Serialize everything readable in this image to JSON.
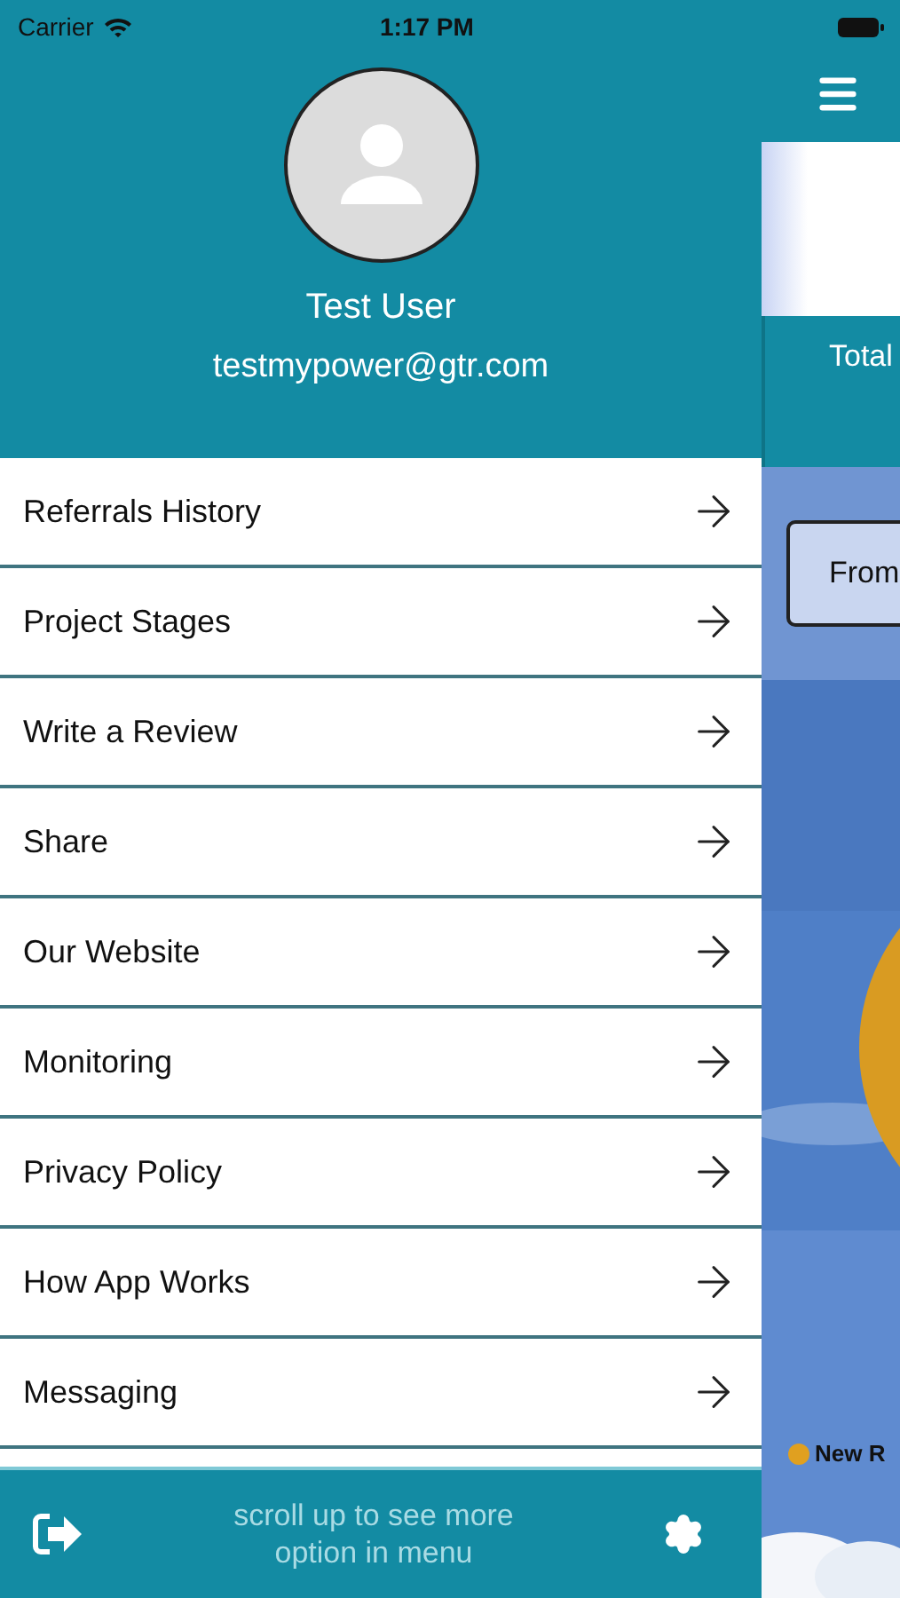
{
  "status_bar": {
    "carrier": "Carrier",
    "time": "1:17 PM"
  },
  "drawer": {
    "user_name": "Test User",
    "email": "testmypower@gtr.com",
    "menu_items": [
      {
        "label": "Referrals History"
      },
      {
        "label": "Project Stages"
      },
      {
        "label": "Write a Review"
      },
      {
        "label": "Share"
      },
      {
        "label": "Our Website"
      },
      {
        "label": "Monitoring"
      },
      {
        "label": "Privacy Policy"
      },
      {
        "label": "How App Works"
      },
      {
        "label": "Messaging"
      }
    ],
    "footer_hint": "scroll up to see more option in menu"
  },
  "background_screen": {
    "total_label": "Total",
    "from_button": "From",
    "legend": [
      {
        "label": "New R",
        "color": "#e0a020"
      }
    ]
  }
}
